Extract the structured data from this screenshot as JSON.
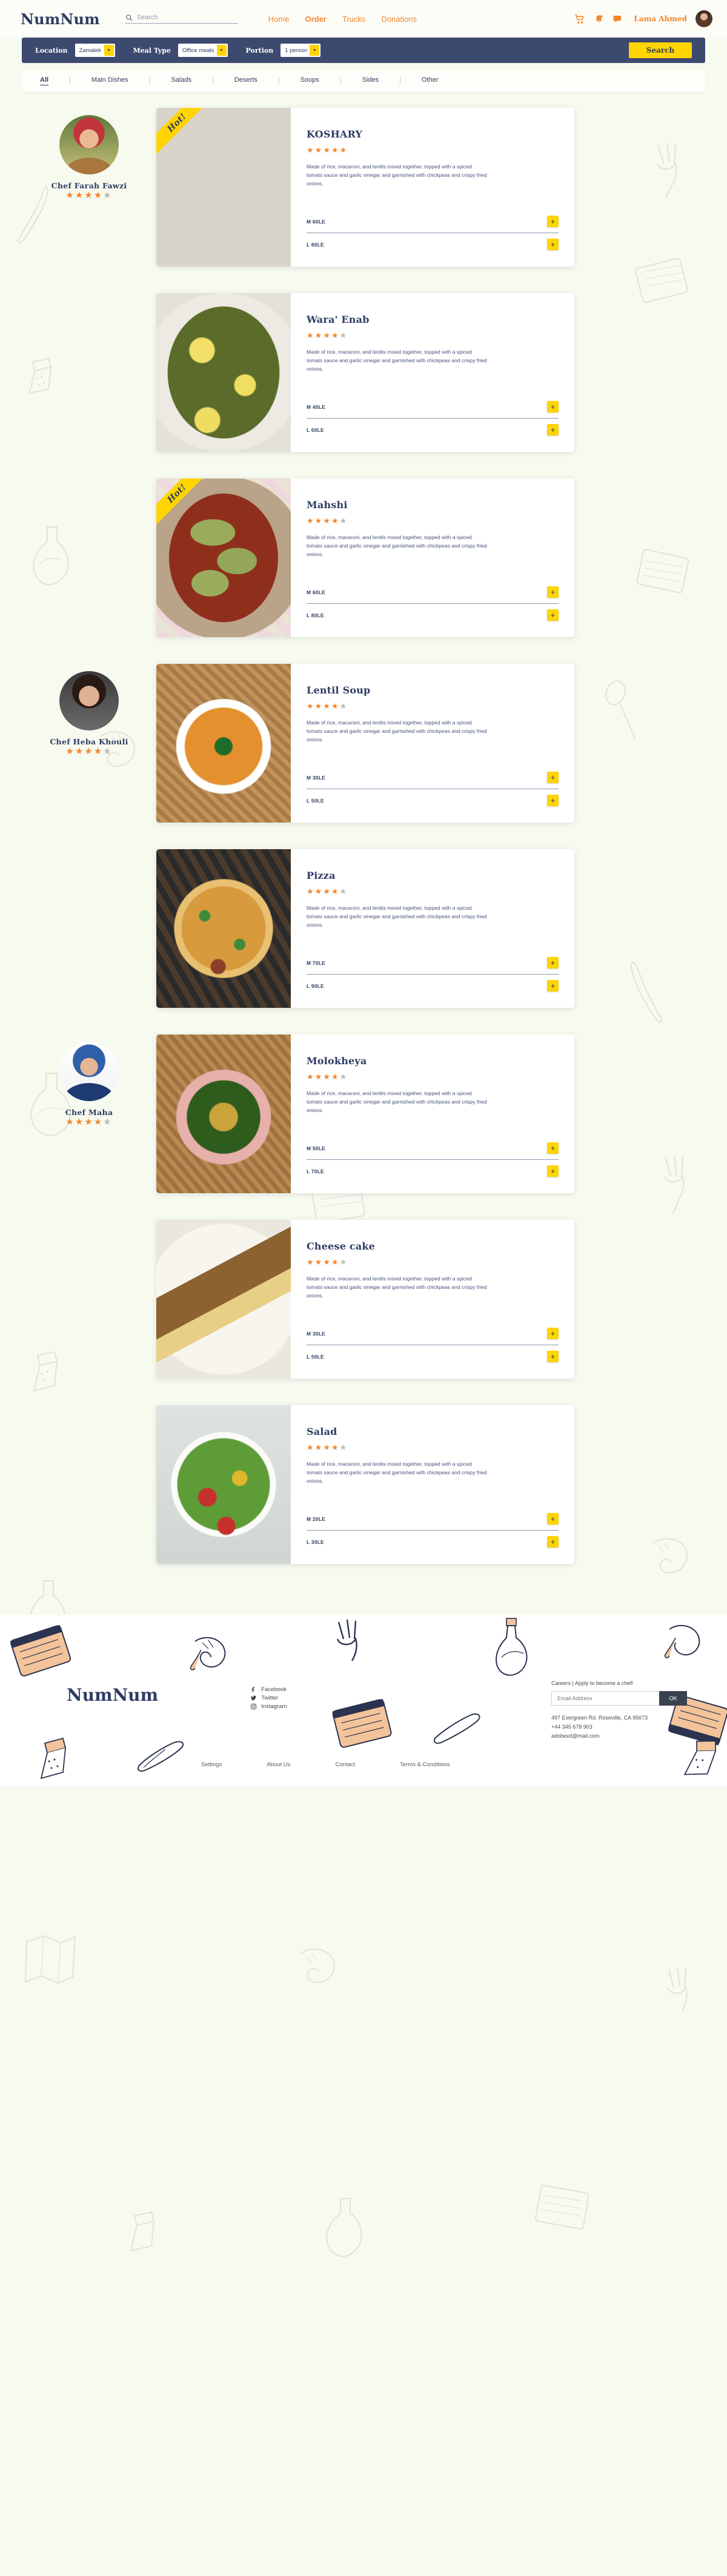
{
  "header": {
    "brand": "NumNum",
    "search": {
      "placeholder": "Search",
      "value": "",
      "icon": "search-icon"
    },
    "nav": [
      {
        "label": "Home",
        "active": false
      },
      {
        "label": "Order",
        "active": true
      },
      {
        "label": "Trucks",
        "active": false
      },
      {
        "label": "Donations",
        "active": false
      }
    ],
    "tools": {
      "cart_icon": "shopping-cart-icon",
      "bell_icon": "notification-bell-icon",
      "chat_icon": "chat-bubble-icon",
      "username": "Lama Ahmed",
      "avatar": "user-avatar"
    }
  },
  "filters": {
    "location_label": "Location",
    "location_value": "Zamalek",
    "mealtype_label": "Meal Type",
    "mealtype_value": "Office meals",
    "portion_label": "Portion",
    "portion_value": "1 person",
    "search_button": "Search"
  },
  "categories": [
    {
      "label": "All",
      "active": true
    },
    {
      "label": "Main Dishes",
      "active": false
    },
    {
      "label": "Salads",
      "active": false
    },
    {
      "label": "Deserts",
      "active": false
    },
    {
      "label": "Soups",
      "active": false
    },
    {
      "label": "Sides",
      "active": false
    },
    {
      "label": "Other",
      "active": false
    }
  ],
  "description_text": "Made of rice, macaroni, and lentils mixed together, topped with a spiced tomato sauce and garlic vinegar and garnished with chickpeas and crispy fried onions.",
  "rows": [
    {
      "chef": {
        "name": "Chef Farah Fawzi",
        "rating": 4,
        "photo": "chef-farah-photo"
      },
      "dish": {
        "name": "KOSHARY",
        "rating": 5,
        "hot": true,
        "hot_label": "Hot!",
        "desc": "Made of rice, macaroni, and lentils mixed together, topped with a spiced tomato sauce and garlic vinegar and garnished with chickpeas and crispy fried onions.",
        "prices": [
          {
            "label": "M 60LE"
          },
          {
            "label": "L 80LE"
          }
        ],
        "image": "koshary-photo"
      }
    },
    {
      "chef": null,
      "dish": {
        "name": "Wara' Enab",
        "rating": 4,
        "hot": false,
        "hot_label": "Hot!",
        "desc": "Made of rice, macaroni, and lentils mixed together, topped with a spiced tomato sauce and garlic vinegar and garnished with chickpeas and crispy fried onions.",
        "prices": [
          {
            "label": "M 40LE"
          },
          {
            "label": "L 60LE"
          }
        ],
        "image": "wara-enab-photo"
      }
    },
    {
      "chef": null,
      "dish": {
        "name": "Mahshi",
        "rating": 4,
        "hot": true,
        "hot_label": "Hot!",
        "desc": "Made of rice, macaroni, and lentils mixed together, topped with a spiced tomato sauce and garlic vinegar and garnished with chickpeas and crispy fried onions.",
        "prices": [
          {
            "label": "M 60LE"
          },
          {
            "label": "L 80LE"
          }
        ],
        "image": "mahshi-photo"
      }
    },
    {
      "chef": {
        "name": "Chef Heba Khouli",
        "rating": 4,
        "photo": "chef-heba-photo"
      },
      "dish": {
        "name": "Lentil Soup",
        "rating": 4,
        "hot": false,
        "hot_label": "Hot!",
        "desc": "Made of rice, macaroni, and lentils mixed together, topped with a spiced tomato sauce and garlic vinegar and garnished with chickpeas and crispy fried onions.",
        "prices": [
          {
            "label": "M 30LE"
          },
          {
            "label": "L 50LE"
          }
        ],
        "image": "lentil-soup-photo"
      }
    },
    {
      "chef": null,
      "dish": {
        "name": "Pizza",
        "rating": 4,
        "hot": false,
        "hot_label": "Hot!",
        "desc": "Made of rice, macaroni, and lentils mixed together, topped with a spiced tomato sauce and garlic vinegar and garnished with chickpeas and crispy fried onions.",
        "prices": [
          {
            "label": "M 70LE"
          },
          {
            "label": "L 90LE"
          }
        ],
        "image": "pizza-photo"
      }
    },
    {
      "chef": {
        "name": "Chef Maha",
        "rating": 4,
        "photo": "chef-maha-photo"
      },
      "dish": {
        "name": "Molokheya",
        "rating": 4,
        "hot": false,
        "hot_label": "Hot!",
        "desc": "Made of rice, macaroni, and lentils mixed together, topped with a spiced tomato sauce and garlic vinegar and garnished with chickpeas and crispy fried onions.",
        "prices": [
          {
            "label": "M 50LE"
          },
          {
            "label": "L 70LE"
          }
        ],
        "image": "molokheya-photo"
      }
    },
    {
      "chef": null,
      "dish": {
        "name": "Cheese cake",
        "rating": 4,
        "hot": false,
        "hot_label": "Hot!",
        "desc": "Made of rice, macaroni, and lentils mixed together, topped with a spiced tomato sauce and garlic vinegar and garnished with chickpeas and crispy fried onions.",
        "prices": [
          {
            "label": "M 30LE"
          },
          {
            "label": "L 50LE"
          }
        ],
        "image": "cheese-cake-photo"
      }
    },
    {
      "chef": null,
      "dish": {
        "name": "Salad",
        "rating": 4,
        "hot": false,
        "hot_label": "Hot!",
        "desc": "Made of rice, macaroni, and lentils mixed together, topped with a spiced tomato sauce and garlic vinegar and garnished with chickpeas and crispy fried onions.",
        "prices": [
          {
            "label": "M 20LE"
          },
          {
            "label": "L 30LE"
          }
        ],
        "image": "salad-photo"
      }
    }
  ],
  "footer": {
    "brand": "NumNum",
    "socials": [
      {
        "label": "Facebook",
        "icon": "facebook-icon"
      },
      {
        "label": "Twitter",
        "icon": "twitter-icon"
      },
      {
        "label": "Instagram",
        "icon": "instagram-icon"
      }
    ],
    "careers_title": "Careers | Apply to become a chef!",
    "email_placeholder": "Email Address",
    "email_value": "",
    "ok_label": "OK",
    "address": "497 Evergreen Rd. Roseville, CA 95673",
    "phone": "+44 345 678 903",
    "email": "adobexd@mail.com",
    "links": [
      {
        "label": "Settings"
      },
      {
        "label": "About Us"
      },
      {
        "label": "Contact"
      },
      {
        "label": "Terms & Conditions"
      }
    ]
  },
  "colors": {
    "page_bg": "#f7faef",
    "navy": "#2e3c63",
    "band_navy": "#3c4a70",
    "orange": "#f2862c",
    "yellow": "#ffd400",
    "star_off": "#b9bcb6",
    "footer_bg": "#ffffff"
  }
}
